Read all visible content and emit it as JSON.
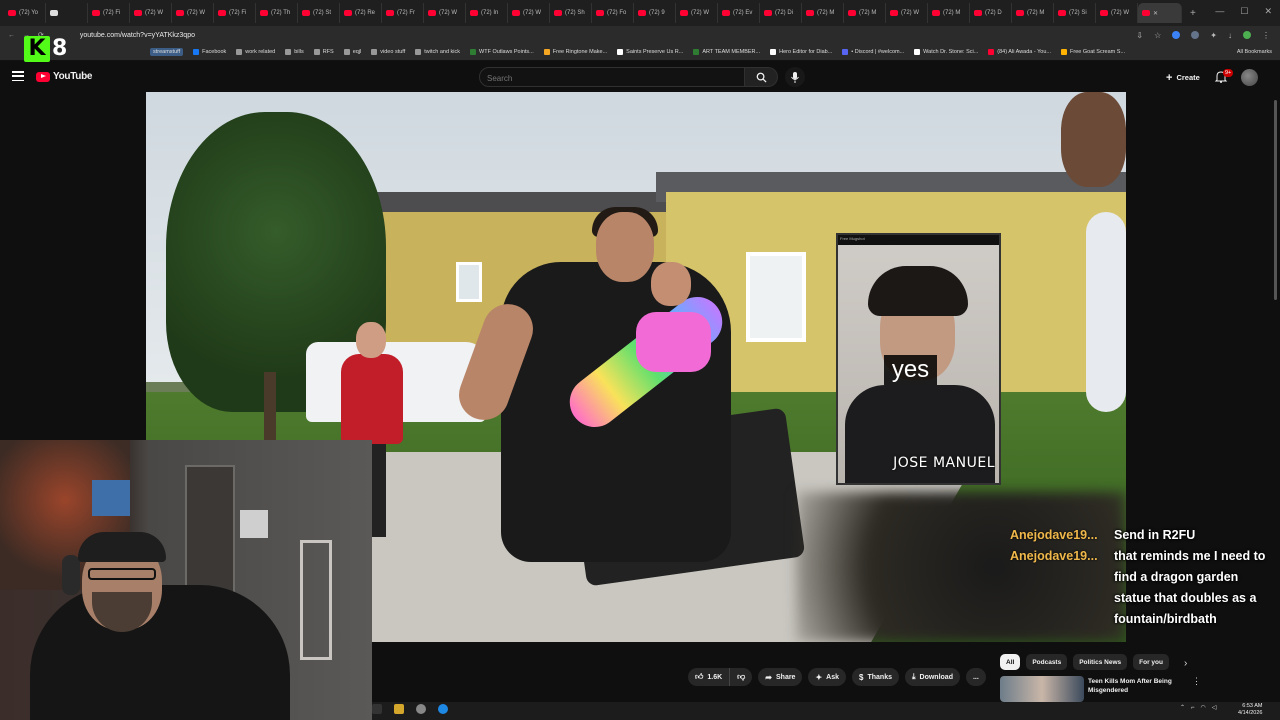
{
  "browser": {
    "tabs": [
      "(72) Yo",
      "",
      "(72) Fi",
      "(72) W",
      "(72) W",
      "(72) Fi",
      "(72) Th",
      "(72) St",
      "(72) Re",
      "(72) Fr",
      "(72) W",
      "(72) In",
      "(72) W",
      "(72) Sh",
      "(72) Fo",
      "(72) 9",
      "(72) W",
      "(72) Ev",
      "(72) Di",
      "(72) M",
      "(72) M",
      "(72) W",
      "(72) M",
      "(72) D",
      "(72) M",
      "(72) Si",
      "(72) W"
    ],
    "url": "youtube.com/watch?v=yYATKkz3qpo",
    "bookmarks": [
      "streamstuff",
      "Facebook",
      "work related",
      "bills",
      "RFS",
      "eqjl",
      "video stuff",
      "twitch and kick",
      "WTF Outlaws Points...",
      "Free Ringtone Make...",
      "Saints Preserve Us R...",
      "ART TEAM MEMBER...",
      "Hero Editor for Diab...",
      "• Discord | #welcom...",
      "Watch Dr. Stone: Sci...",
      "(84) Ali Awada - You...",
      "Free Goat Scream S..."
    ],
    "all_bookmarks": "All Bookmarks"
  },
  "overlay": {
    "kick_letter": "K",
    "kick_number": "8"
  },
  "youtube": {
    "logo_text": "YouTube",
    "search_placeholder": "Search",
    "create_label": "Create",
    "notifications_count": "9+"
  },
  "video": {
    "mugshot_small_label": "Free Mugshot",
    "mugshot_caption": "yes",
    "mugshot_name": "JOSE MANUEL"
  },
  "chat": [
    {
      "user": "Anejodave19...",
      "message": "Send in R2FU"
    },
    {
      "user": "Anejodave19...",
      "message": "that reminds me I need to find a dragon garden statue that doubles as a fountain/birdbath"
    }
  ],
  "actions": {
    "likes": "1.6K",
    "share": "Share",
    "ask": "Ask",
    "thanks": "Thanks",
    "download": "Download",
    "more": "..."
  },
  "chips": [
    "All",
    "Podcasts",
    "Politics News",
    "For you"
  ],
  "recommendation": {
    "title": "Teen Kills Mom After Being Misgendered"
  },
  "taskbar": {
    "time": "6:53 AM",
    "date": "4/14/2026"
  },
  "colors": {
    "youtube_red": "#ff0033",
    "kick_green": "#53fc18",
    "chat_username": "#f0b84a"
  }
}
